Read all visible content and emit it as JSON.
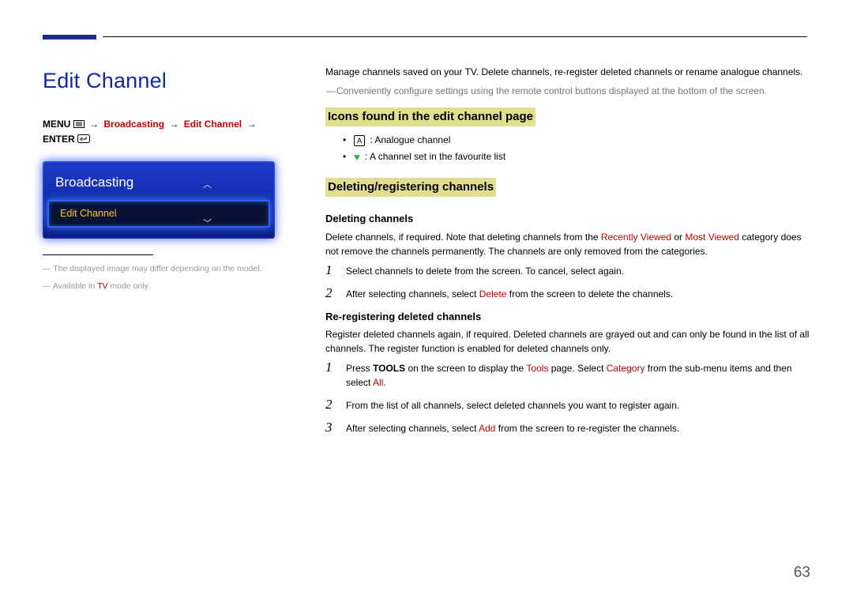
{
  "pageTitle": "Edit Channel",
  "breadcrumb": {
    "menu": "MENU",
    "broadcasting": "Broadcasting",
    "editChannel": "Edit Channel",
    "enter": "ENTER"
  },
  "panel": {
    "title": "Broadcasting",
    "selected": "Edit Channel"
  },
  "footnotes": {
    "f1": "The displayed image may differ depending on the model.",
    "f2a": "Available in ",
    "f2b": "TV",
    "f2c": " mode only."
  },
  "intro": "Manage channels saved on your TV. Delete channels, re-register deleted channels or rename analogue channels.",
  "introNote": "Conveniently configure settings using the remote control buttons displayed at the bottom of the screen.",
  "sections": {
    "icons": {
      "title": "Icons found in the edit channel page",
      "itemA": " : Analogue channel",
      "itemHeart": " : A channel set in the favourite list"
    },
    "deleting": {
      "title": "Deleting/registering channels",
      "sub1": "Deleting channels",
      "sub1text_a": "Delete channels, if required. Note that deleting channels from the ",
      "sub1text_b": "Recently Viewed",
      "sub1text_c": " or ",
      "sub1text_d": "Most Viewed",
      "sub1text_e": " category does not remove the channels permanently. The channels are only removed from the categories.",
      "steps1": {
        "s1": "Select channels to delete from the screen. To cancel, select again.",
        "s2a": "After selecting channels, select ",
        "s2b": "Delete",
        "s2c": " from the screen to delete the channels."
      },
      "sub2": "Re-registering deleted channels",
      "sub2text": "Register deleted channels again, if required. Deleted channels are grayed out and can only be found in the list of all channels. The register function is enabled for deleted channels only.",
      "steps2": {
        "s1a": "Press ",
        "s1b": "TOOLS",
        "s1c": " on the screen to display the ",
        "s1d": "Tools",
        "s1e": " page. Select ",
        "s1f": "Category",
        "s1g": " from the sub-menu items and then select ",
        "s1h": "All",
        "s1i": ".",
        "s2": "From the list of all channels, select deleted channels you want to register again.",
        "s3a": "After selecting channels, select ",
        "s3b": "Add",
        "s3c": " from the screen to re-register the channels."
      }
    }
  },
  "pageNumber": "63"
}
